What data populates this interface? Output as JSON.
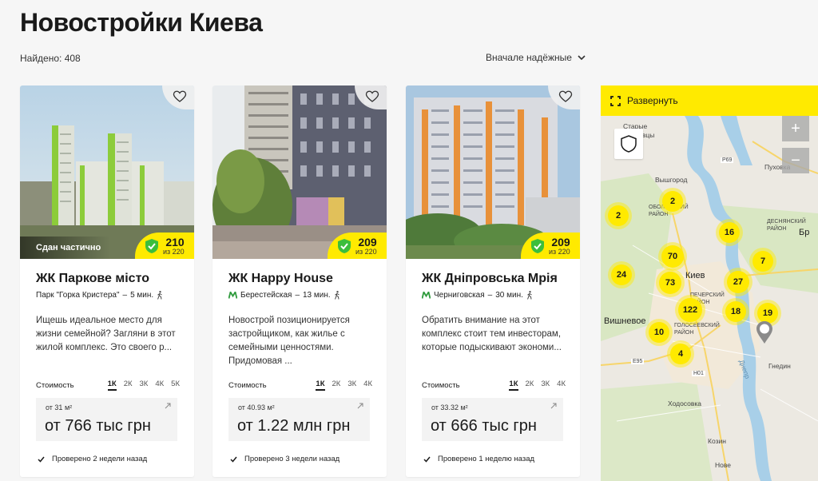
{
  "page": {
    "title": "Новостройки Киева",
    "found": "Найдено: 408",
    "sort_label": "Вначале надёжные"
  },
  "cards": [
    {
      "status": "Сдан частично",
      "score": "210",
      "score_total": "из 220",
      "name": "ЖК Паркове місто",
      "location": "Парк \"Горка Кристера\"",
      "separator": "–",
      "distance": "5 мин.",
      "description": "Ищешь идеальное место для жизни семейной? Загляни в этот жилой комплекс. Это своего р...",
      "cost_label": "Стоимость",
      "rooms": [
        "1К",
        "2К",
        "3К",
        "4К",
        "5К"
      ],
      "area": "от 31 м²",
      "price": "от 766 тыс грн",
      "verified": "Проверено 2 недели назад"
    },
    {
      "status": "",
      "score": "209",
      "score_total": "из 220",
      "name": "ЖК Happy House",
      "location": "Берестейская",
      "separator": "–",
      "distance": "13 мин.",
      "description": "Новострой позиционируется застройщиком, как жилье с семейными ценностями. Придомовая ...",
      "cost_label": "Стоимость",
      "rooms": [
        "1К",
        "2К",
        "3К",
        "4К"
      ],
      "area": "от 40.93 м²",
      "price": "от 1.22 млн грн",
      "verified": "Проверено 3 недели назад"
    },
    {
      "status": "",
      "score": "209",
      "score_total": "из 220",
      "name": "ЖК Дніпровська Мрія",
      "location": "Черниговская",
      "separator": "–",
      "distance": "30 мин.",
      "description": "Обратить внимание на этот комплекс стоит тем инвесторам, которые подыскивают экономи...",
      "cost_label": "Стоимость",
      "rooms": [
        "1К",
        "2К",
        "3К",
        "4К"
      ],
      "area": "от 33.32 м²",
      "price": "от 666 тыс грн",
      "verified": "Проверено 1 неделю назад"
    }
  ],
  "map": {
    "expand_label": "Развернуть",
    "zoom_in": "+",
    "zoom_out": "−",
    "clusters": [
      "2",
      "2",
      "16",
      "70",
      "7",
      "24",
      "73",
      "27",
      "122",
      "18",
      "19",
      "10",
      "4"
    ],
    "labels": {
      "starye_petrivtsi": "Старые Петровцы",
      "vyshgorod": "Вышгород",
      "obolon": "ОБОЛОНСКИЙ РАЙОН",
      "desnyansky": "ДЕСНЯНСКИЙ РАЙОН",
      "kyiv": "Киев",
      "pechersky": "ПЕЧЕРСКИЙ РАЙОН",
      "holosiivsky": "ГОЛОСЕЕВСКИЙ РАЙОН",
      "vyshneve": "Вишневое",
      "khodosivka": "Ходосовка",
      "kozyn": "Козин",
      "hnidyn": "Гнедин",
      "puhivka": "Пуховка",
      "br": "Бр",
      "nove": "Нове",
      "r69": "P69",
      "e95": "E95",
      "h01": "H01",
      "dnipro": "Днепр"
    }
  },
  "colors": {
    "accent": "#ffea00",
    "metro_green": "#2e9a3c",
    "shield_green": "#3cbe3c"
  }
}
